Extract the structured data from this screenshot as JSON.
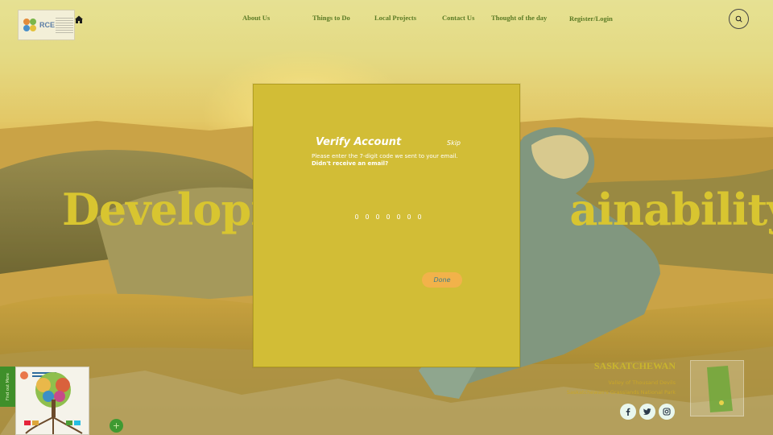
{
  "brand": {
    "logo_text": "RCE"
  },
  "nav": {
    "items": [
      {
        "label": "About Us"
      },
      {
        "label": "Things to Do"
      },
      {
        "label": "Local Projects"
      },
      {
        "label": "Contact Us"
      },
      {
        "label": "Thought of the day"
      },
      {
        "label": "Register/Login"
      }
    ],
    "home_icon": "home-icon",
    "search_icon": "search-icon"
  },
  "hero": {
    "title": "Development and Sustainability",
    "visible_left": "Developm",
    "visible_right": "ainability"
  },
  "modal": {
    "title": "Verify Account",
    "skip_label": "Skip",
    "instruction": "Please enter the 7-digit code we sent to your email.",
    "resend_prompt": "Didn't receive an email?",
    "code_placeholders": [
      "0",
      "0",
      "0",
      "0",
      "0",
      "0",
      "0"
    ],
    "done_label": "Done"
  },
  "side_tab": {
    "label": "Find out More"
  },
  "plus_label": "+",
  "location": {
    "title": "SASKATCHEWAN",
    "line1": "Valley of Thousand Devils",
    "line2": "Saskatchewan's Grasslands National Park"
  },
  "social": [
    "facebook-icon",
    "twitter-icon",
    "instagram-icon"
  ],
  "colors": {
    "modal_bg": "#d2bd36",
    "done_button": "#f2b24a",
    "nav_text": "#5a7a24",
    "hero_text": "#d8c530"
  }
}
